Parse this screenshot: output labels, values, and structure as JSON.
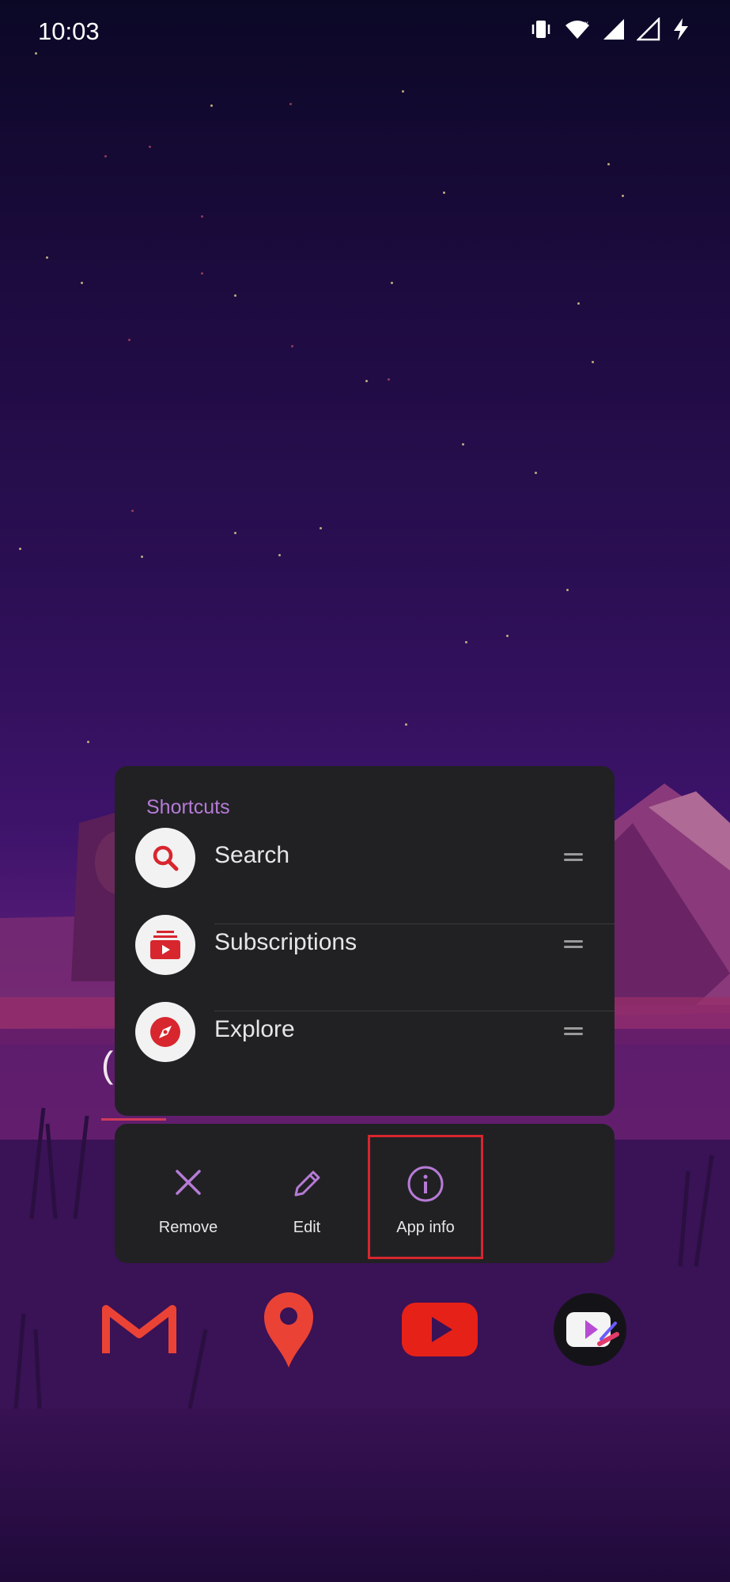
{
  "status_bar": {
    "time": "10:03",
    "icons": [
      "vibrate-icon",
      "wifi-icon",
      "signal-x-icon",
      "signal-icon",
      "charging-icon"
    ]
  },
  "shortcuts_menu": {
    "title": "Shortcuts",
    "items": [
      {
        "label": "Search",
        "icon": "search-icon"
      },
      {
        "label": "Subscriptions",
        "icon": "subscriptions-icon"
      },
      {
        "label": "Explore",
        "icon": "compass-icon"
      }
    ]
  },
  "actions": [
    {
      "label": "Remove",
      "icon": "close-icon"
    },
    {
      "label": "Edit",
      "icon": "pencil-icon"
    },
    {
      "label": "App info",
      "icon": "info-icon"
    }
  ],
  "dock": [
    "gmail-icon",
    "maps-pin-icon",
    "youtube-icon",
    "video-player-icon"
  ],
  "colors": {
    "accent_purple": "#b67bd6",
    "panel_bg": "#212124",
    "youtube_red": "#e62117",
    "highlight_red": "#d8262e"
  }
}
